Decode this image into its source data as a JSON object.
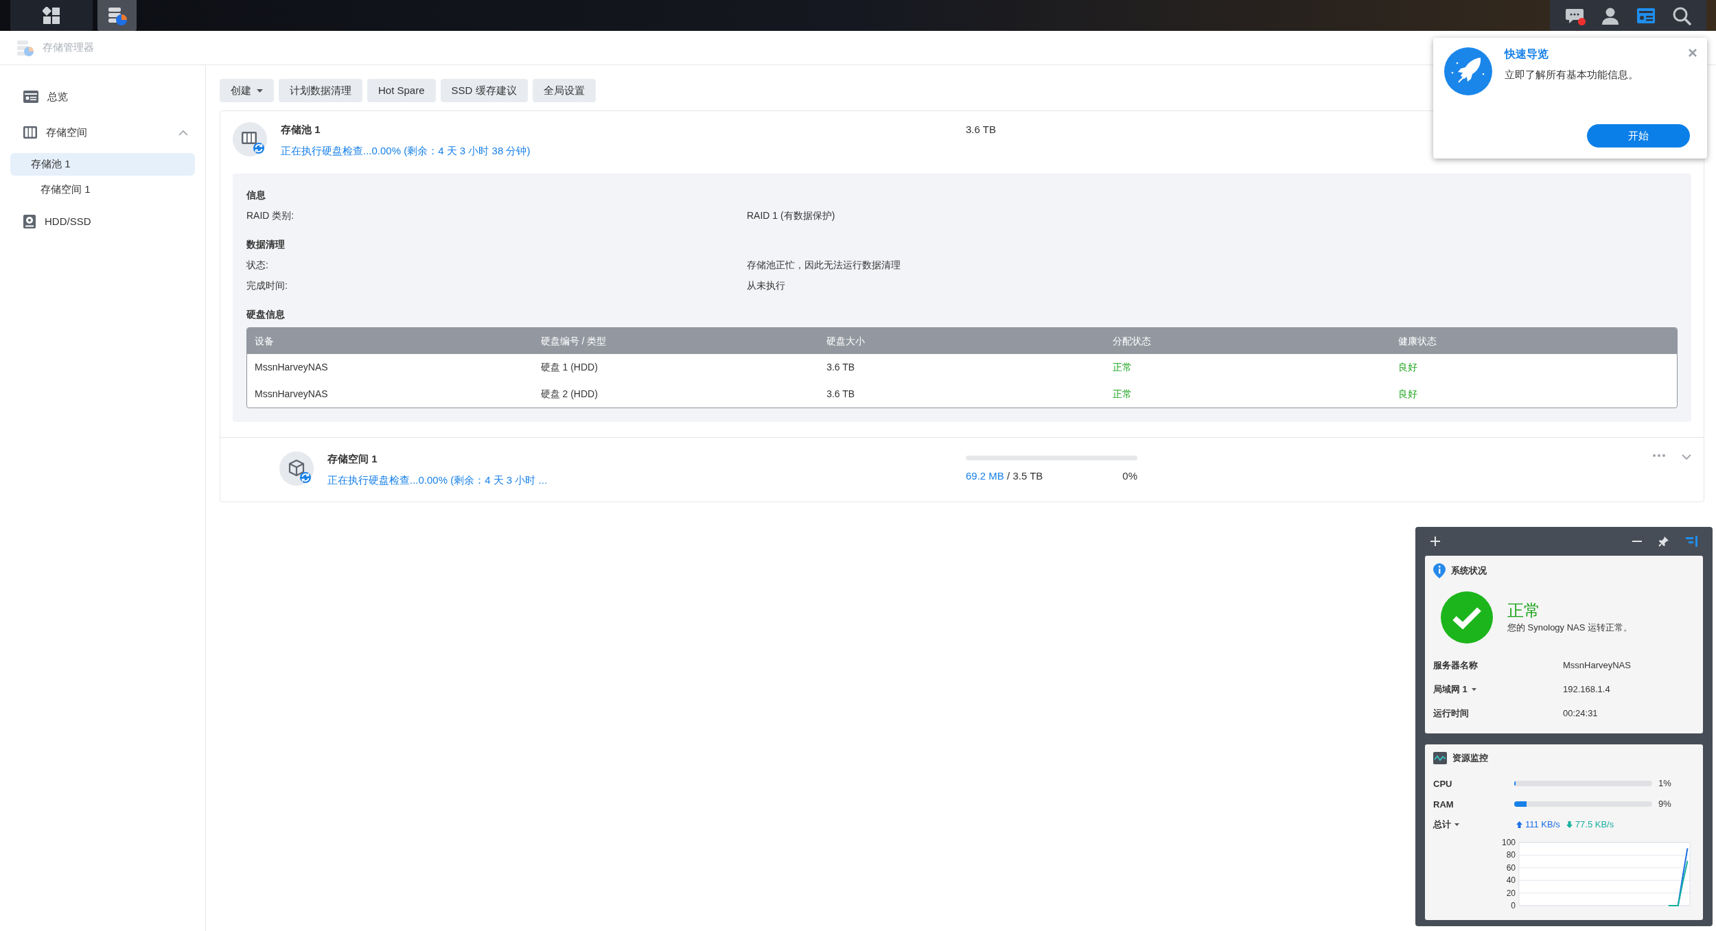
{
  "taskbar": {
    "items": [
      {
        "kind": "menu",
        "selected": false
      },
      {
        "kind": "storage",
        "selected": true
      }
    ],
    "tray": [
      {
        "kind": "chat",
        "notification": true,
        "selected": false
      },
      {
        "kind": "user",
        "notification": false,
        "selected": false
      },
      {
        "kind": "widgets",
        "notification": false,
        "selected": true
      },
      {
        "kind": "search",
        "notification": false,
        "selected": false
      }
    ]
  },
  "window": {
    "title": "存储管理器"
  },
  "sidebar": {
    "items": [
      {
        "label": "总览",
        "kind": "overview",
        "selected": false
      },
      {
        "label": "存储空间",
        "kind": "volume",
        "selected": false,
        "expanded": true,
        "children": [
          {
            "label": "存储池 1",
            "selected": true,
            "children": [
              {
                "label": "存储空间 1",
                "selected": false
              }
            ]
          }
        ]
      },
      {
        "label": "HDD/SSD",
        "kind": "disk",
        "selected": false
      }
    ]
  },
  "toolbar": [
    {
      "label": "创建",
      "dropdown": true
    },
    {
      "label": "计划数据清理",
      "dropdown": false
    },
    {
      "label": "Hot Spare",
      "dropdown": false
    },
    {
      "label": "SSD 缓存建议",
      "dropdown": false
    },
    {
      "label": "全局设置",
      "dropdown": false
    }
  ],
  "pool": {
    "title": "存储池 1",
    "status": "正在执行硬盘检查...0.00% (剩余：4 天 3 小时 38 分钟)",
    "size": "3.6 TB",
    "expanded": true,
    "sections": [
      {
        "heading": "信息",
        "rows": [
          {
            "label": "RAID 类别:",
            "value": "RAID 1 (有数据保护)"
          }
        ]
      },
      {
        "heading": "数据清理",
        "rows": [
          {
            "label": "状态:",
            "value": "存储池正忙，因此无法运行数据清理"
          },
          {
            "label": "完成时间:",
            "value": "从未执行"
          }
        ]
      }
    ],
    "disk_heading": "硬盘信息",
    "table": {
      "columns": [
        {
          "label": "设备",
          "kind": "text"
        },
        {
          "label": "硬盘编号 / 类型",
          "kind": "text"
        },
        {
          "label": "硬盘大小",
          "kind": "text"
        },
        {
          "label": "分配状态",
          "kind": "status"
        },
        {
          "label": "健康状态",
          "kind": "status"
        }
      ],
      "rows": [
        [
          "MssnHarveyNAS",
          "硬盘 1 (HDD)",
          "3.6 TB",
          "正常",
          "良好"
        ],
        [
          "MssnHarveyNAS",
          "硬盘 2 (HDD)",
          "3.6 TB",
          "正常",
          "良好"
        ]
      ]
    }
  },
  "volume": {
    "title": "存储空间 1",
    "status": "正在执行硬盘检查...0.00% (剩余：4 天 3 小时 ...",
    "level": 0.0,
    "used": "69.2 MB",
    "total": "/ 3.5 TB",
    "percent": "0%"
  },
  "quick_tour": {
    "title": "快速导览",
    "text": "立即了解所有基本功能信息。",
    "button": "开始"
  },
  "widget": {
    "system": {
      "title": "系统状况",
      "status": "正常",
      "message": "您的 Synology NAS 运转正常。",
      "rows": [
        {
          "label": "服务器名称",
          "value": "MssnHarveyNAS",
          "dropdown": false
        },
        {
          "label": "局域网 1",
          "value": "192.168.1.4",
          "dropdown": true
        },
        {
          "label": "运行时间",
          "value": "00:24:31",
          "dropdown": false
        }
      ]
    },
    "monitor": {
      "title": "资源监控",
      "meters": [
        {
          "label": "CPU",
          "level": 0.01,
          "reading": "1%"
        },
        {
          "label": "RAM",
          "level": 0.09,
          "reading": "9%"
        }
      ],
      "total": {
        "label": "总计",
        "upload": "111 KB/s",
        "download": "77.5 KB/s"
      },
      "chart_data": {
        "type": "line",
        "ylim": [
          0,
          100
        ],
        "yticks": [
          0,
          20,
          40,
          60,
          80,
          100
        ],
        "grid": true,
        "series": [
          {
            "color": "#1f6fe5",
            "values": [
              null,
              null,
              null,
              null,
              null,
              null,
              null,
              null,
              null,
              null,
              null,
              null,
              null,
              null,
              null,
              null,
              null,
              null,
              null,
              null,
              null,
              null,
              null,
              null,
              null,
              null,
              null,
              null,
              null,
              null,
              null,
              0,
              0,
              0,
              47,
              91
            ]
          },
          {
            "color": "#16b0a0",
            "values": [
              null,
              null,
              null,
              null,
              null,
              null,
              null,
              null,
              null,
              null,
              null,
              null,
              null,
              null,
              null,
              null,
              null,
              null,
              null,
              null,
              null,
              null,
              null,
              null,
              null,
              null,
              null,
              null,
              null,
              null,
              null,
              0,
              0,
              0,
              37,
              71
            ]
          }
        ]
      }
    }
  }
}
